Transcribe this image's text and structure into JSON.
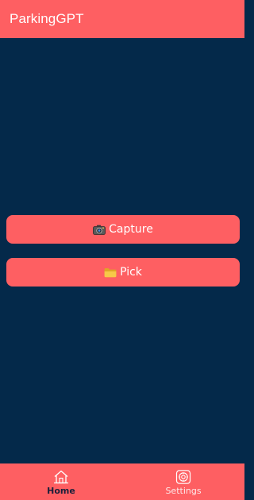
{
  "app_bar": {
    "title": "ParkingGPT"
  },
  "actions": {
    "capture": {
      "icon": "camera-icon",
      "label": "Capture"
    },
    "pick": {
      "icon": "folder-icon",
      "label": "Pick"
    }
  },
  "bottom_nav": {
    "items": [
      {
        "label": "Home",
        "icon": "home-icon",
        "active": true
      },
      {
        "label": "Settings",
        "icon": "settings-icon",
        "active": false
      }
    ]
  },
  "colors": {
    "primary": "#fe5f62",
    "background": "#04294a",
    "active_nav_text": "#1a1f3a",
    "inactive_nav_text": "#fde8e8"
  }
}
